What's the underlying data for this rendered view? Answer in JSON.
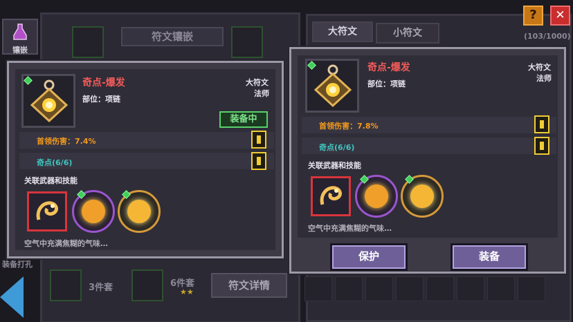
{
  "background": {
    "side_button_label": "镶嵌",
    "left_title": "符文镶嵌",
    "tabs": [
      "大符文",
      "小符文"
    ],
    "rune_count": "(103/1000)",
    "set_three_label": "3件套",
    "set_six_label": "6件套",
    "rune_detail_button": "符文详情",
    "bottom_left_text": "装备打孔",
    "help_label": "?",
    "close_label": "✕"
  },
  "left_card": {
    "name": "奇点-爆发",
    "slot": "部位：项链",
    "type": "大符文",
    "class": "法师",
    "equipped_badge": "装备中",
    "stats": [
      "首领伤害：7.4%",
      "奇点(6/6)"
    ],
    "linked_section": "关联武器和技能",
    "description": "空气中充满焦糊的气味…",
    "linked_items": [
      "dragon-weapon-icon",
      "fire-orb-icon",
      "sun-orb-icon"
    ]
  },
  "right_card": {
    "name": "奇点-爆发",
    "slot": "部位：项链",
    "type": "大符文",
    "class": "法师",
    "stats": [
      "首领伤害：7.8%",
      "奇点(6/6)"
    ],
    "linked_section": "关联武器和技能",
    "description": "空气中充满焦糊的气味…",
    "protect_button": "保护",
    "equip_button": "装备",
    "linked_items": [
      "dragon-weapon-icon",
      "fire-orb-icon",
      "sun-orb-icon"
    ]
  },
  "colors": {
    "title_red": "#f25b5b",
    "stat_orange": "#f29a1c",
    "stat_teal": "#3fc6c0",
    "equipped_green": "#58d16a",
    "lock_yellow": "#f0cc35",
    "button_purple": "#6f5f99"
  }
}
